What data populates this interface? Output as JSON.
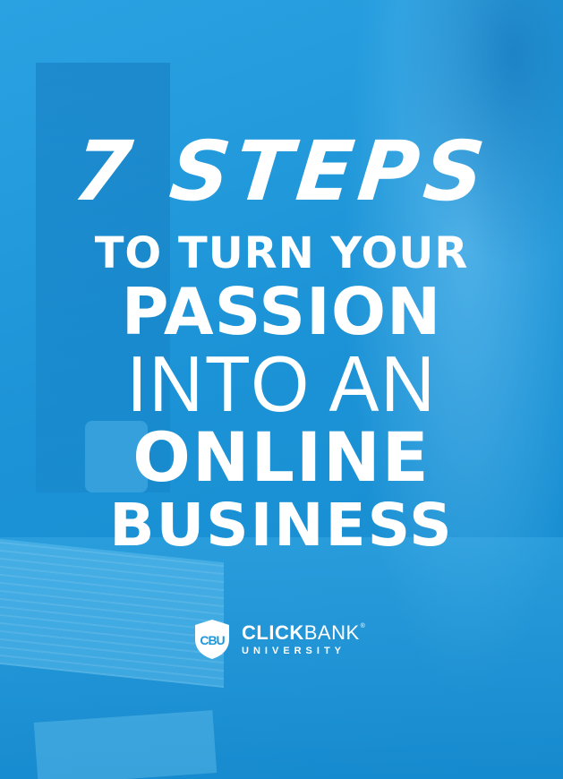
{
  "headline": {
    "line1": "7 STEPS",
    "line2": "TO TURN YOUR",
    "line3": "PASSION",
    "line4": "INTO AN",
    "line5": "ONLINE",
    "line6": "BUSINESS"
  },
  "logo": {
    "monogram": "CBU",
    "brand_bold": "CLICK",
    "brand_thin": "BANK",
    "registered": "®",
    "subtitle": "UNIVERSITY"
  },
  "colors": {
    "background": "#1f98d8",
    "text": "#ffffff"
  }
}
